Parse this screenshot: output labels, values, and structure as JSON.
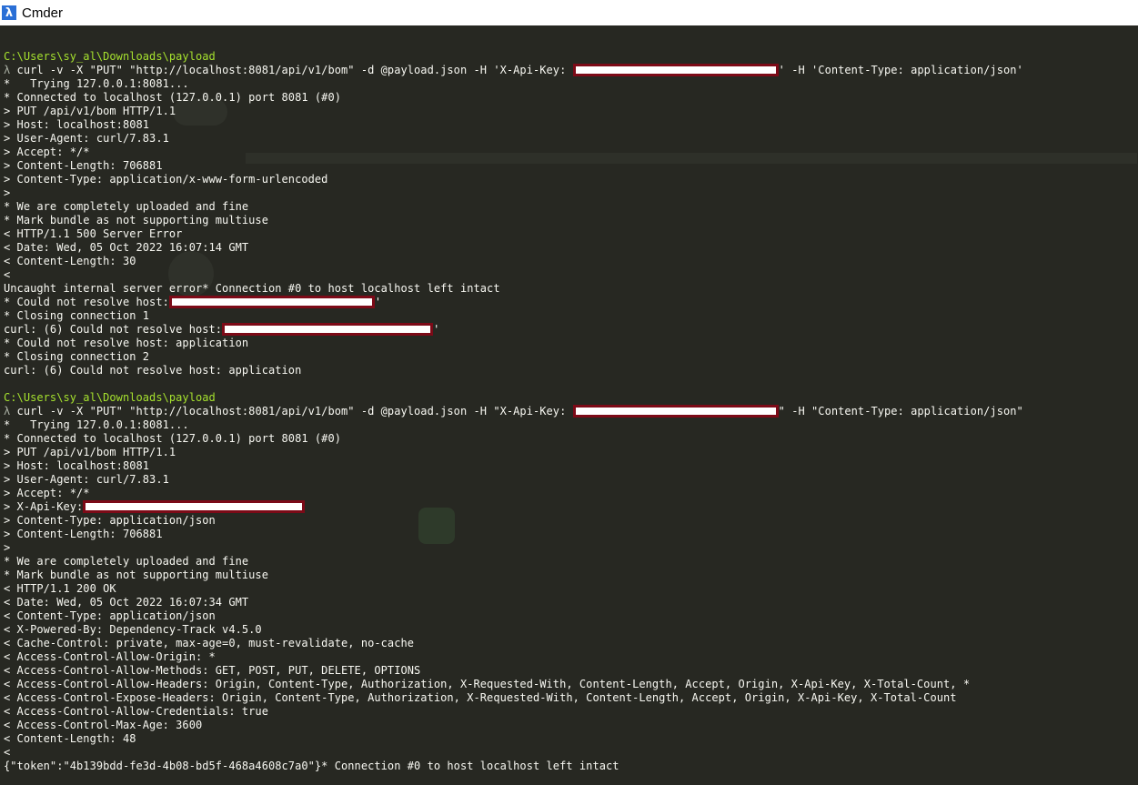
{
  "window": {
    "title": "Cmder",
    "icon": "lambda-icon",
    "icon_glyph": "λ"
  },
  "colors": {
    "console_bg": "#272822",
    "path_text": "#a6e22e",
    "text": "#f8f8f2",
    "redaction_border": "#7c0a17",
    "redaction_fill": "#ffffff"
  },
  "console": {
    "block1": {
      "path": "C:\\Users\\sy_al\\Downloads\\payload",
      "prompt": "λ",
      "cmd_before": " curl -v -X \"PUT\" \"http://localhost:8081/api/v1/bom\" -d @payload.json -H 'X-Api-Key:",
      "cmd_after": "' -H 'Content-Type: application/json'",
      "l1": "*   Trying 127.0.0.1:8081...",
      "l2": "* Connected to localhost (127.0.0.1) port 8081 (#0)",
      "l3": "> PUT /api/v1/bom HTTP/1.1",
      "l4": "> Host: localhost:8081",
      "l5": "> User-Agent: curl/7.83.1",
      "l6": "> Accept: */*",
      "l7": "> Content-Length: 706881",
      "l8": "> Content-Type: application/x-www-form-urlencoded",
      "l9": ">",
      "l10": "* We are completely uploaded and fine",
      "l11": "* Mark bundle as not supporting multiuse",
      "l12": "< HTTP/1.1 500 Server Error",
      "l13": "< Date: Wed, 05 Oct 2022 16:07:14 GMT",
      "l14": "< Content-Length: 30",
      "l15": "<",
      "l16": "Uncaught internal server error* Connection #0 to host localhost left intact",
      "l17_before": "* Could not resolve host:",
      "l17_after": "'",
      "l18": "* Closing connection 1",
      "l19_before": "curl: (6) Could not resolve host:",
      "l19_after": "'",
      "l20": "* Could not resolve host: application",
      "l21": "* Closing connection 2",
      "l22": "curl: (6) Could not resolve host: application"
    },
    "block2": {
      "path": "C:\\Users\\sy_al\\Downloads\\payload",
      "prompt": "λ",
      "cmd_before": " curl -v -X \"PUT\" \"http://localhost:8081/api/v1/bom\" -d @payload.json -H \"X-Api-Key:",
      "cmd_after": "\" -H \"Content-Type: application/json\"",
      "l1": "*   Trying 127.0.0.1:8081...",
      "l2": "* Connected to localhost (127.0.0.1) port 8081 (#0)",
      "l3": "> PUT /api/v1/bom HTTP/1.1",
      "l4": "> Host: localhost:8081",
      "l5": "> User-Agent: curl/7.83.1",
      "l6": "> Accept: */*",
      "l7_before": "> X-Api-Key:",
      "l8": "> Content-Type: application/json",
      "l9": "> Content-Length: 706881",
      "l10": ">",
      "l11": "* We are completely uploaded and fine",
      "l12": "* Mark bundle as not supporting multiuse",
      "l13": "< HTTP/1.1 200 OK",
      "l14": "< Date: Wed, 05 Oct 2022 16:07:34 GMT",
      "l15": "< Content-Type: application/json",
      "l16": "< X-Powered-By: Dependency-Track v4.5.0",
      "l17": "< Cache-Control: private, max-age=0, must-revalidate, no-cache",
      "l18": "< Access-Control-Allow-Origin: *",
      "l19": "< Access-Control-Allow-Methods: GET, POST, PUT, DELETE, OPTIONS",
      "l20": "< Access-Control-Allow-Headers: Origin, Content-Type, Authorization, X-Requested-With, Content-Length, Accept, Origin, X-Api-Key, X-Total-Count, *",
      "l21": "< Access-Control-Expose-Headers: Origin, Content-Type, Authorization, X-Requested-With, Content-Length, Accept, Origin, X-Api-Key, X-Total-Count",
      "l22": "< Access-Control-Allow-Credentials: true",
      "l23": "< Access-Control-Max-Age: 3600",
      "l24": "< Content-Length: 48",
      "l25": "<",
      "l26": "{\"token\":\"4b139bdd-fe3d-4b08-bd5f-468a4608c7a0\"}* Connection #0 to host localhost left intact"
    }
  }
}
